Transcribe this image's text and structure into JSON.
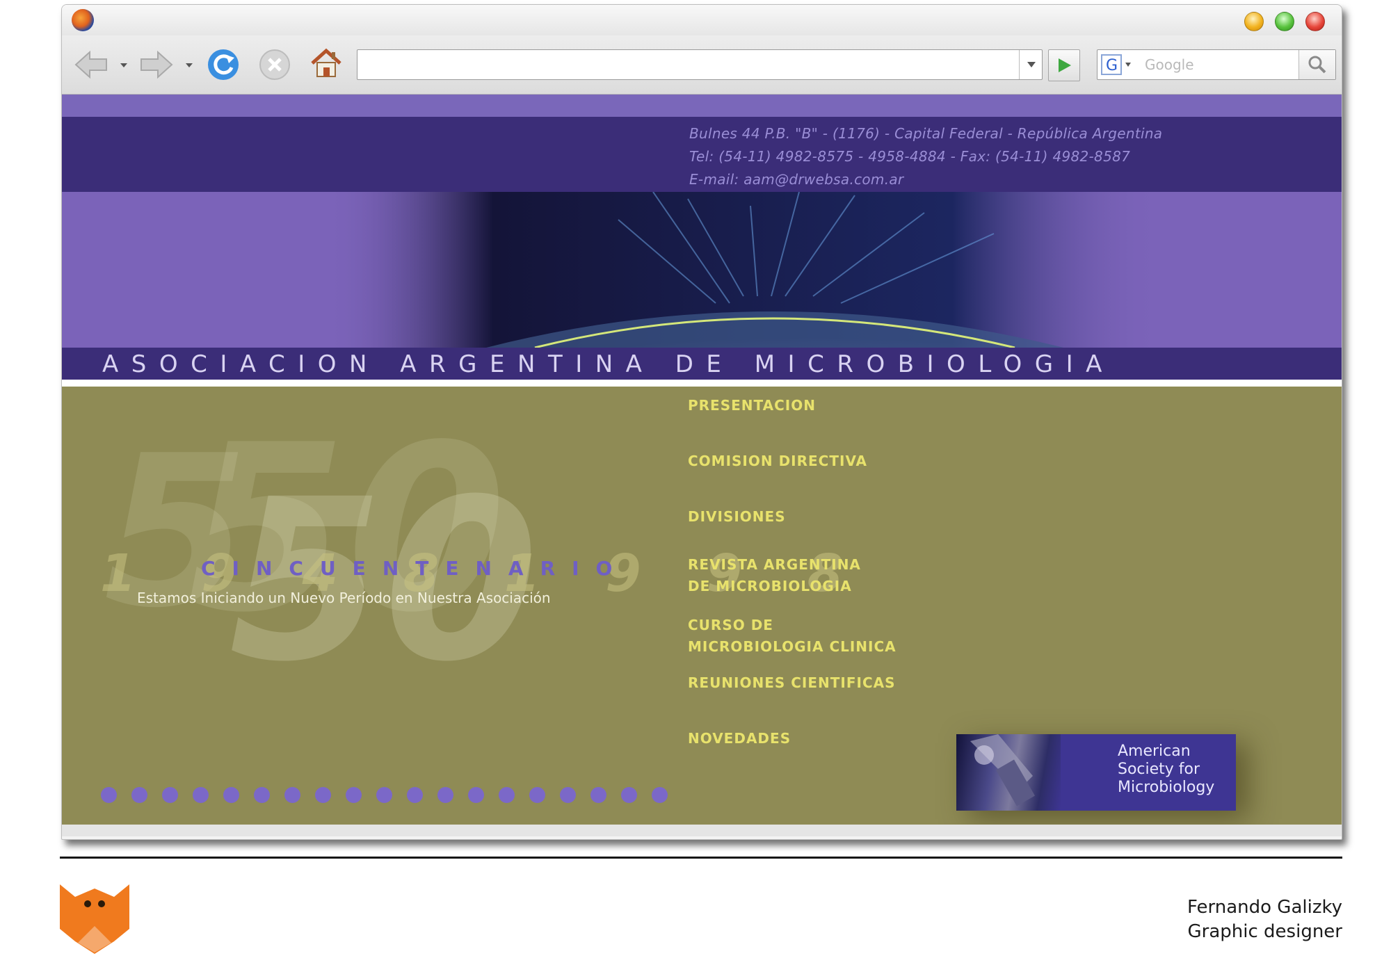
{
  "browser": {
    "url": "",
    "search": {
      "engine": "Google",
      "placeholder": "Google"
    }
  },
  "site": {
    "contact": {
      "address": "Bulnes 44 P.B. \"B\" - (1176) - Capital Federal - República Argentina",
      "phones": "Tel: (54-11) 4982-8575 - 4958-4884 - Fax: (54-11) 4982-8587",
      "email": "E-mail: aam@drwebsa.com.ar"
    },
    "title": "ASOCIACION ARGENTINA DE MICROBIOLOGIA",
    "anniversary": {
      "numbers": "50",
      "years": "1 9 4 8   1 9 9 8",
      "heading": "CINCUENTENARIO",
      "subtitle": "Estamos Iniciando un Nuevo Período en Nuestra Asociación"
    },
    "menu": [
      "PRESENTACION",
      "COMISION DIRECTIVA",
      "DIVISIONES",
      "REVISTA ARGENTINA\nDE MICROBIOLOGIA",
      "CURSO DE\nMICROBIOLOGIA CLINICA",
      "REUNIONES CIENTIFICAS",
      "NOVEDADES"
    ],
    "sponsor": "American\nSociety for\nMicrobiology",
    "dots_count": 19
  },
  "footer": {
    "name": "Fernando Galizky",
    "role": "Graphic designer"
  },
  "colors": {
    "purple_dark": "#3b2d78",
    "purple": "#7a67ba",
    "olive": "#8f8b55",
    "menu_text": "#e8e26c"
  }
}
